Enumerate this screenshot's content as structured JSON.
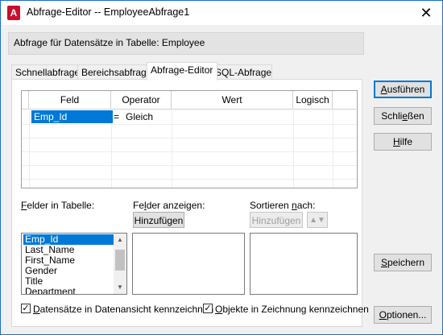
{
  "window": {
    "title": "Abfrage-Editor -- EmployeeAbfrage1",
    "close_glyph": "✕",
    "app_icon_letter": "A"
  },
  "info": {
    "text": "Abfrage für Datensätze in Tabelle:  Employee"
  },
  "tabs": [
    {
      "label": "Schnellabfrage",
      "active": false
    },
    {
      "label": "Bereichsabfrage",
      "active": false
    },
    {
      "label": "Abfrage-Editor",
      "active": true
    },
    {
      "label": "SQL-Abfrage",
      "active": false
    }
  ],
  "grid": {
    "columns": [
      "Feld",
      "Operator",
      "Wert",
      "Logisch"
    ],
    "rows": [
      {
        "feld": "Emp_Id",
        "eq": "=",
        "operator": "Gleich",
        "wert": "",
        "logisch": ""
      }
    ]
  },
  "felder_in_tabelle": {
    "label_prefix": "F",
    "label_rest": "elder in Tabelle:",
    "items": [
      "Emp_Id",
      "Last_Name",
      "First_Name",
      "Gender",
      "Title",
      "Department"
    ],
    "selected": "Emp_Id"
  },
  "felder_anzeigen": {
    "label_a": "Fe",
    "label_u": "l",
    "label_b": "der anzeigen:",
    "button": "Hinzufügen"
  },
  "sortieren_nach": {
    "label_a": "Sortieren ",
    "label_u": "n",
    "label_b": "ach:",
    "button": "Hinzufügen",
    "sort_glyph": "▲▼"
  },
  "checkboxes": {
    "datensaetze": {
      "label_u": "D",
      "label_rest": "atensätze in Datenansicht kennzeichnen",
      "checked": true
    },
    "objekte": {
      "label_u": "O",
      "label_rest": "bjekte in Zeichnung kennzeichnen",
      "checked": true
    }
  },
  "side_buttons": {
    "ausfuehren": {
      "u": "A",
      "rest": "usführen"
    },
    "schliessen": {
      "pre": "Schli",
      "u": "e",
      "rest": "ßen"
    },
    "hilfe": {
      "u": "H",
      "rest": "ilfe"
    },
    "speichern": {
      "u": "S",
      "rest": "peichern"
    },
    "optionen": {
      "u": "O",
      "rest": "ptionen..."
    }
  }
}
